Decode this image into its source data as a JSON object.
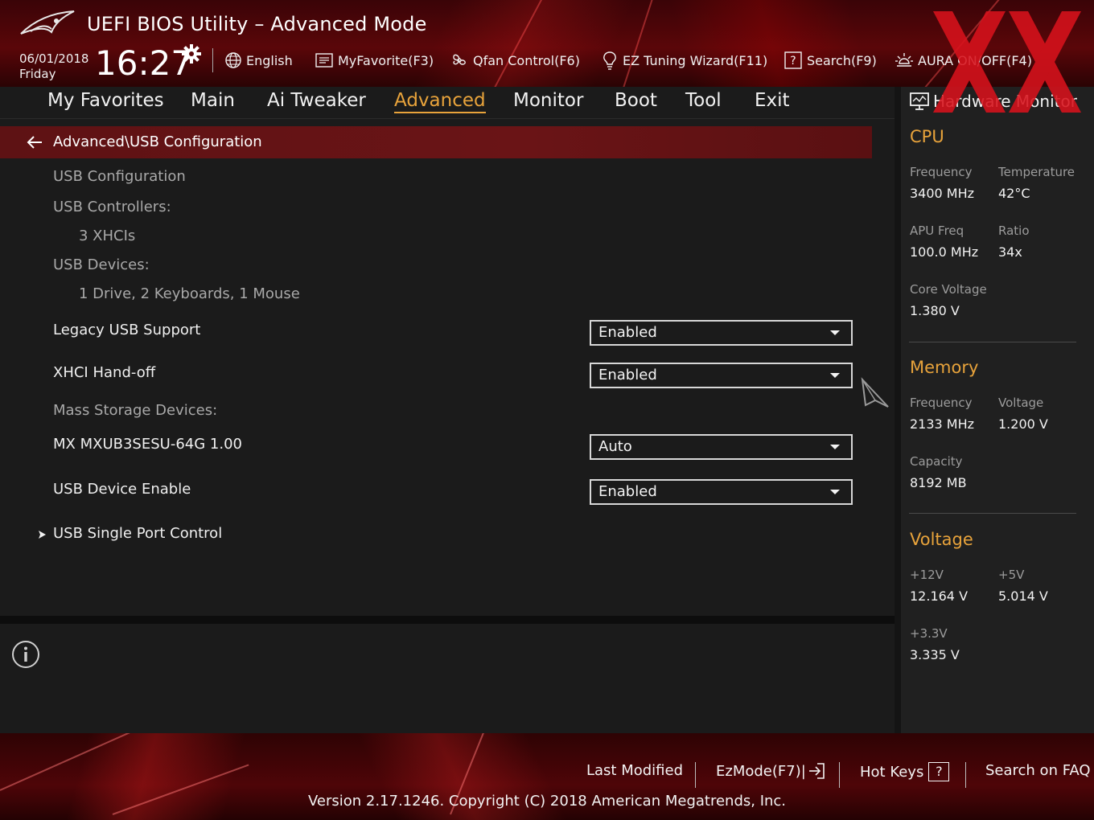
{
  "header": {
    "title": "UEFI BIOS Utility – Advanced Mode",
    "date": "06/01/2018",
    "day": "Friday",
    "time": "16:27",
    "toolbar": {
      "language": "English",
      "my_favorite": "MyFavorite(F3)",
      "qfan": "Qfan Control(F6)",
      "ez_tuning": "EZ Tuning Wizard(F11)",
      "search": "Search(F9)",
      "aura": "AURA ON/OFF(F4)"
    }
  },
  "tabs": [
    {
      "label": "My Favorites"
    },
    {
      "label": "Main"
    },
    {
      "label": "Ai Tweaker"
    },
    {
      "label": "Advanced"
    },
    {
      "label": "Monitor"
    },
    {
      "label": "Boot"
    },
    {
      "label": "Tool"
    },
    {
      "label": "Exit"
    }
  ],
  "active_tab": "Advanced",
  "breadcrumb": "Advanced\\USB Configuration",
  "content": {
    "usb_configuration": "USB Configuration",
    "usb_controllers_label": "USB Controllers:",
    "usb_controllers_value": "3 XHCIs",
    "usb_devices_label": "USB Devices:",
    "usb_devices_value": "1 Drive, 2 Keyboards, 1 Mouse",
    "legacy_usb_label": "Legacy USB Support",
    "legacy_usb_value": "Enabled",
    "xhci_handoff_label": "XHCI Hand-off",
    "xhci_handoff_value": "Enabled",
    "mass_storage_label": "Mass Storage Devices:",
    "mass_storage_device_label": "MX MXUB3SESU-64G 1.00",
    "mass_storage_device_value": "Auto",
    "usb_device_enable_label": "USB Device Enable",
    "usb_device_enable_value": "Enabled",
    "usb_single_port_control": "USB Single Port Control"
  },
  "hardware_monitor": {
    "title": "Hardware Monitor",
    "cpu": {
      "title": "CPU",
      "frequency_label": "Frequency",
      "frequency_value": "3400 MHz",
      "temperature_label": "Temperature",
      "temperature_value": "42°C",
      "apu_freq_label": "APU Freq",
      "apu_freq_value": "100.0 MHz",
      "ratio_label": "Ratio",
      "ratio_value": "34x",
      "core_voltage_label": "Core Voltage",
      "core_voltage_value": "1.380 V"
    },
    "memory": {
      "title": "Memory",
      "frequency_label": "Frequency",
      "frequency_value": "2133 MHz",
      "voltage_label": "Voltage",
      "voltage_value": "1.200 V",
      "capacity_label": "Capacity",
      "capacity_value": "8192 MB"
    },
    "voltage": {
      "title": "Voltage",
      "v12_label": "+12V",
      "v12_value": "12.164 V",
      "v5_label": "+5V",
      "v5_value": "5.014 V",
      "v33_label": "+3.3V",
      "v33_value": "3.335 V"
    }
  },
  "footer": {
    "last_modified": "Last Modified",
    "ezmode": "EzMode(F7)|",
    "hot_keys": "Hot Keys",
    "hot_keys_key": "?",
    "search_faq": "Search on FAQ",
    "version": "Version 2.17.1246. Copyright (C) 2018 American Megatrends, Inc."
  },
  "colors": {
    "accent": "#e8a33b",
    "breadcrumb_bg": "#6a1416",
    "panel_bg": "#1b1b1b",
    "header_red": "#5a0609"
  },
  "icons": [
    "rog-logo-icon",
    "gear-icon",
    "globe-icon",
    "favorite-list-icon",
    "fan-icon",
    "lightbulb-icon",
    "search-icon",
    "aura-icon",
    "monitor-icon",
    "back-arrow-icon",
    "chevron-right-icon",
    "cursor-icon",
    "info-icon",
    "exit-to-box-icon"
  ]
}
